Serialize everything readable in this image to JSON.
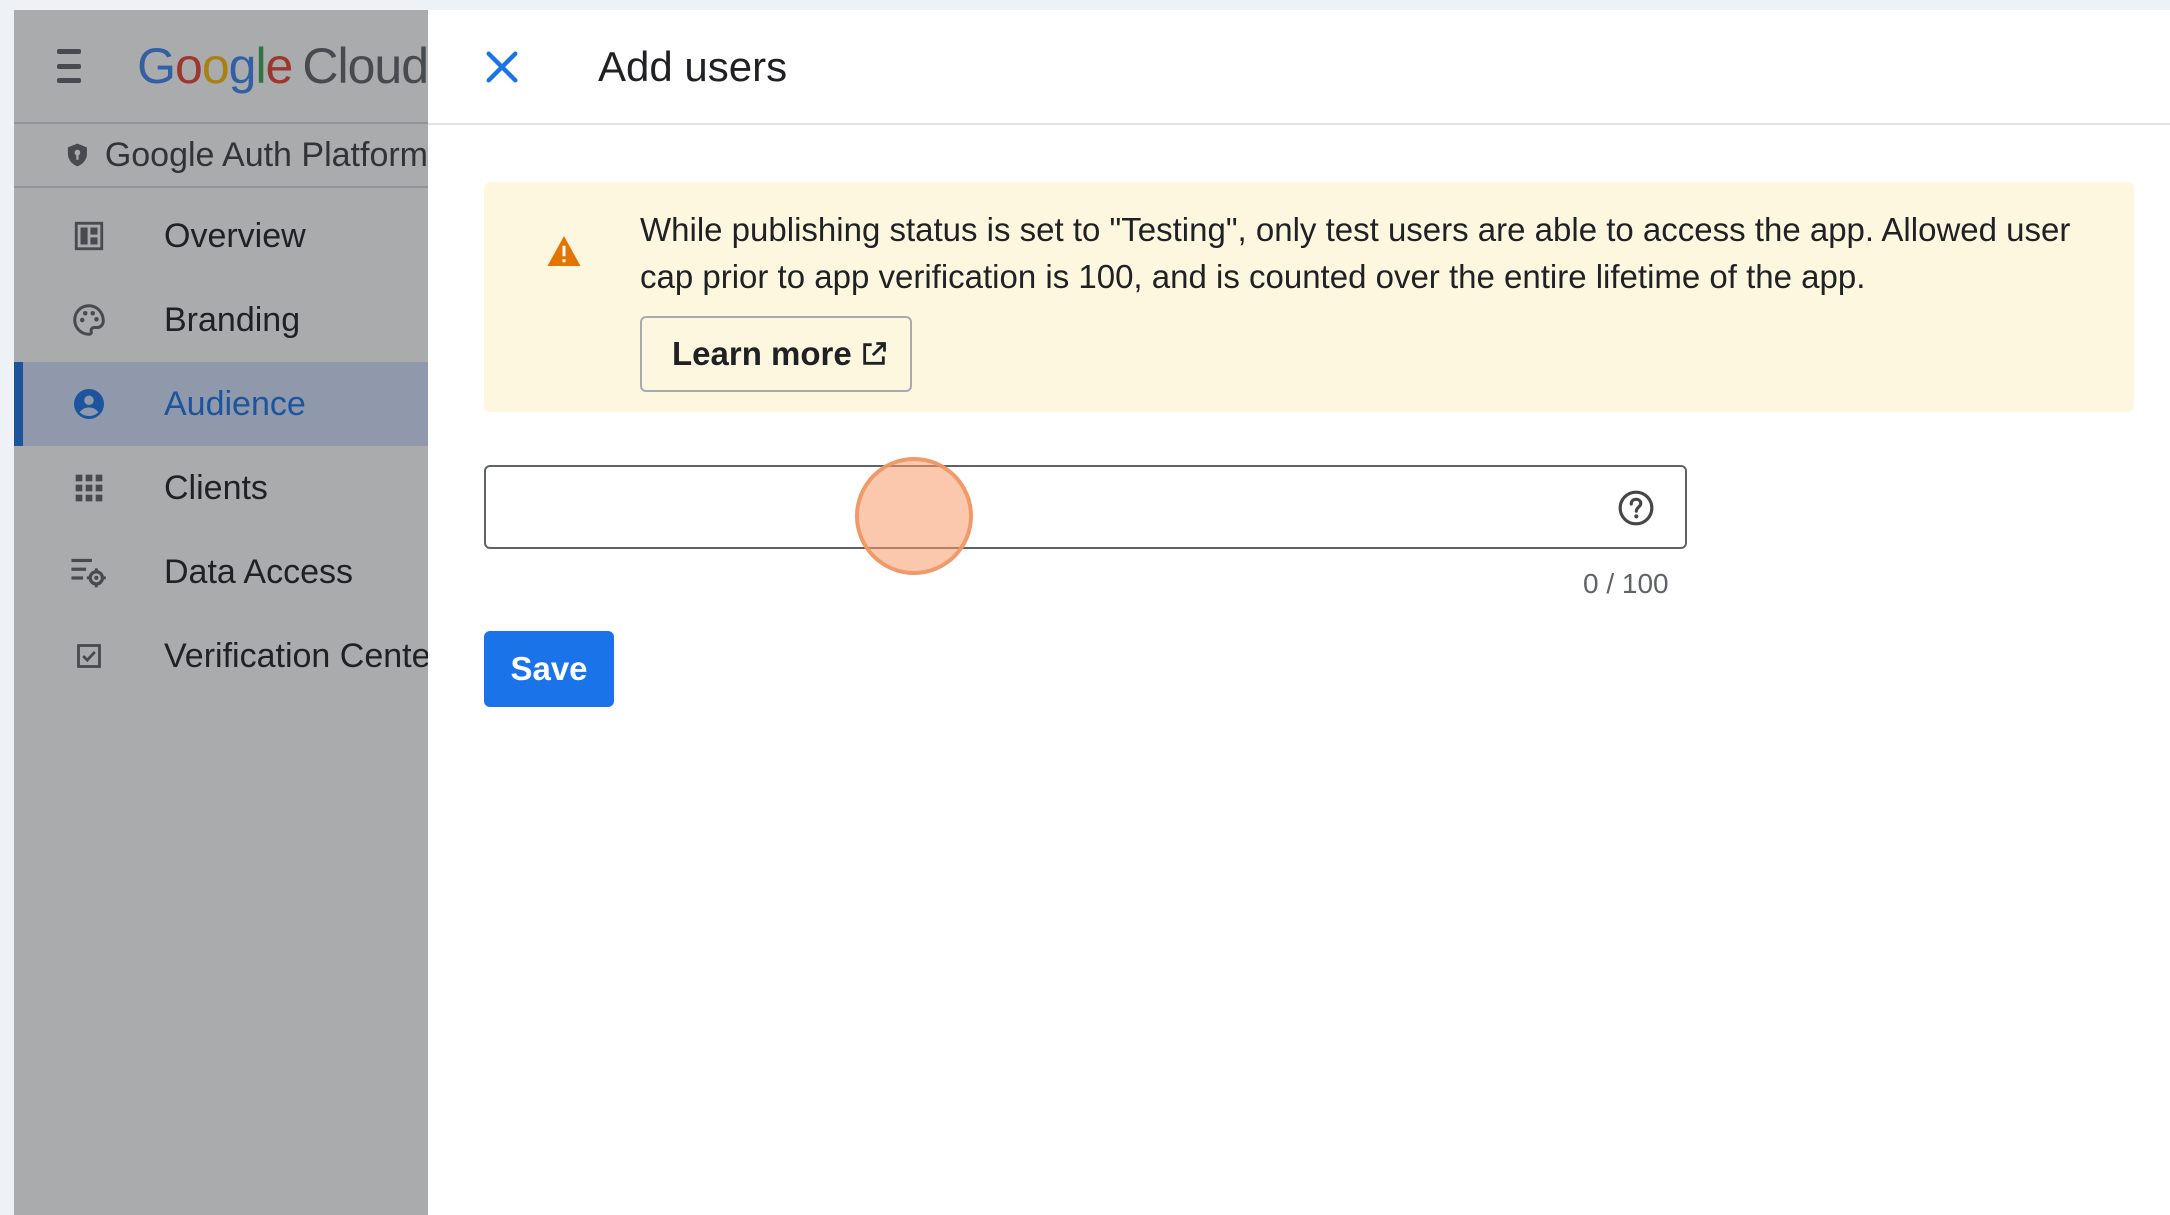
{
  "sidebar": {
    "logo": {
      "letters": [
        "G",
        "o",
        "o",
        "g",
        "l",
        "e"
      ],
      "cloud": "Cloud"
    },
    "product_name": "Google Auth Platform",
    "items": [
      {
        "label": "Overview",
        "icon": "dashboard-icon",
        "active": false
      },
      {
        "label": "Branding",
        "icon": "palette-icon",
        "active": false
      },
      {
        "label": "Audience",
        "icon": "account-circle-icon",
        "active": true
      },
      {
        "label": "Clients",
        "icon": "apps-grid-icon",
        "active": false
      },
      {
        "label": "Data Access",
        "icon": "manage-search-icon",
        "active": false
      },
      {
        "label": "Verification Center",
        "icon": "checkbox-icon",
        "active": false
      }
    ]
  },
  "panel": {
    "title": "Add users",
    "banner": {
      "text": "While publishing status is set to \"Testing\", only test users are able to access the app. Allowed user cap prior to app verification is 100, and is counted over the entire lifetime of the app.",
      "learn_more": "Learn more"
    },
    "email_input": {
      "value": "",
      "placeholder": ""
    },
    "counter": "0 / 100",
    "save_label": "Save"
  },
  "colors": {
    "accent": "#1a73e8",
    "warning": "#e37400",
    "banner_bg": "#fef7e0",
    "active_nav_bg": "#d3e3fd",
    "click_indicator": "#f79b69"
  }
}
